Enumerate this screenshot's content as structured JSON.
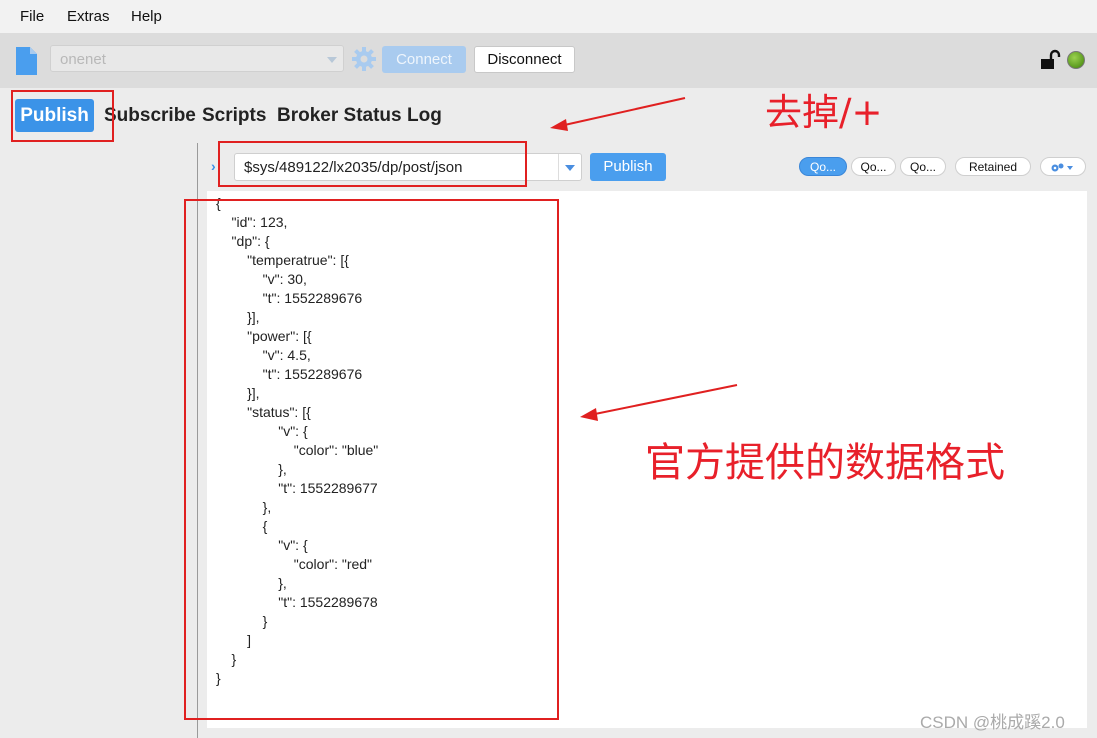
{
  "menu": {
    "items": [
      "File",
      "Extras",
      "Help"
    ]
  },
  "connection": {
    "profile": "onenet",
    "connect_label": "Connect",
    "disconnect_label": "Disconnect"
  },
  "tabs": {
    "active": "Publish",
    "items": [
      "Subscribe",
      "Scripts",
      "Broker Status",
      "Log"
    ]
  },
  "publish": {
    "topic": "$sys/489122/lx2035/dp/post/json",
    "button_label": "Publish",
    "qos_labels": [
      "Qo...",
      "Qo...",
      "Qo..."
    ],
    "retained_label": "Retained"
  },
  "payload_lines": [
    "{",
    "    \"id\": 123,",
    "    \"dp\": {",
    "        \"temperatrue\": [{",
    "            \"v\": 30,",
    "            \"t\": 1552289676",
    "        }],",
    "        \"power\": [{",
    "            \"v\": 4.5,",
    "            \"t\": 1552289676",
    "        }],",
    "        \"status\": [{",
    "                \"v\": {",
    "                    \"color\": \"blue\"",
    "                },",
    "                \"t\": 1552289677",
    "            },",
    "            {",
    "                \"v\": {",
    "                    \"color\": \"red\"",
    "                },",
    "                \"t\": 1552289678",
    "            }",
    "        ]",
    "    }",
    "}"
  ],
  "annotations": {
    "remove_note": "去掉/+",
    "format_note": "官方提供的数据格式",
    "color": "#e02020"
  },
  "watermark": "CSDN @桃成蹊2.0"
}
